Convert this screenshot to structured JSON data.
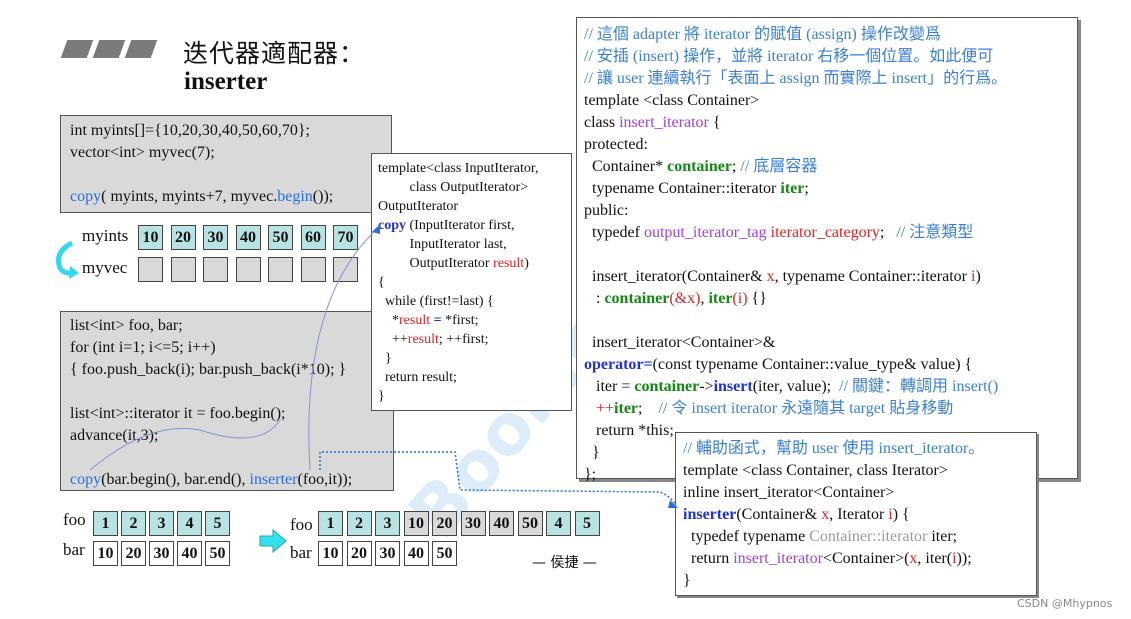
{
  "title": {
    "line1": "迭代器適配器：",
    "line2": "inserter"
  },
  "example1": [
    [
      [
        "int myints[]={10,20,30,40,50,60,70};",
        ""
      ]
    ],
    [
      [
        "vector<int> myvec(7);",
        ""
      ]
    ],
    [
      [
        "",
        ""
      ]
    ],
    [
      [
        "copy",
        "bl"
      ],
      [
        "( myints, myints+7, myvec.",
        ""
      ],
      [
        "begin",
        "bl"
      ],
      [
        "());",
        ""
      ]
    ]
  ],
  "arrays1": {
    "myints_label": "myints",
    "myvec_label": "myvec",
    "myints": [
      "10",
      "20",
      "30",
      "40",
      "50",
      "60",
      "70"
    ],
    "myvec": [
      "",
      "",
      "",
      "",
      "",
      "",
      ""
    ]
  },
  "example2": [
    [
      [
        "list<int> foo, bar;",
        ""
      ]
    ],
    [
      [
        "for (int i=1; i<=5; i++)",
        ""
      ]
    ],
    [
      [
        "{ foo.push_back(i); bar.push_back(i*10); }",
        ""
      ]
    ],
    [
      [
        "",
        ""
      ]
    ],
    [
      [
        "list<int>::iterator it = foo.begin();",
        ""
      ]
    ],
    [
      [
        "advance(it,3);",
        ""
      ]
    ],
    [
      [
        "",
        ""
      ]
    ],
    [
      [
        "copy",
        "bl"
      ],
      [
        "(bar.begin(), bar.end(), ",
        ""
      ],
      [
        "inserter",
        "bl"
      ],
      [
        "(foo,it));",
        ""
      ]
    ]
  ],
  "copy_box": [
    [
      [
        "template<class InputIterator,",
        ""
      ]
    ],
    [
      [
        "         class OutputIterator>",
        ""
      ]
    ],
    [
      [
        "OutputIterator",
        ""
      ]
    ],
    [
      [
        "copy",
        "bb"
      ],
      [
        " (InputIterator first,",
        ""
      ]
    ],
    [
      [
        "         InputIterator last,",
        ""
      ]
    ],
    [
      [
        "         OutputIterator ",
        ""
      ],
      [
        "result",
        "r"
      ],
      [
        ")",
        ""
      ]
    ],
    [
      [
        "{",
        ""
      ]
    ],
    [
      [
        "  while (first!=last) {",
        ""
      ]
    ],
    [
      [
        "    *",
        ""
      ],
      [
        "result",
        "r"
      ],
      [
        " ",
        ""
      ],
      [
        "=",
        "bb"
      ],
      [
        " *first;",
        ""
      ]
    ],
    [
      [
        "    ++",
        ""
      ],
      [
        "result",
        "r"
      ],
      [
        "; ++first;",
        ""
      ]
    ],
    [
      [
        "  }",
        ""
      ]
    ],
    [
      [
        "  return result;",
        ""
      ]
    ],
    [
      [
        "}",
        ""
      ]
    ]
  ],
  "insert_iterator_box": [
    [
      [
        "// 這個 adapter 將 iterator 的賦值 (assign) 操作改變爲",
        "c"
      ]
    ],
    [
      [
        "// 安插 (insert) 操作，並將 iterator 右移一個位置。如此便可",
        "c"
      ]
    ],
    [
      [
        "// 讓 user 連續執行「表面上 assign 而實際上 insert」的行爲。",
        "c"
      ]
    ],
    [
      [
        "template <class Container>",
        ""
      ]
    ],
    [
      [
        "class ",
        ""
      ],
      [
        "insert_iterator",
        "k"
      ],
      [
        " {",
        ""
      ]
    ],
    [
      [
        "protected:",
        ""
      ]
    ],
    [
      [
        "  Container* ",
        ""
      ],
      [
        "container",
        "g"
      ],
      [
        "; ",
        ""
      ],
      [
        "// 底層容器",
        "c"
      ]
    ],
    [
      [
        "  typename Container::iterator ",
        ""
      ],
      [
        "iter",
        "g"
      ],
      [
        ";",
        ""
      ]
    ],
    [
      [
        "public:",
        ""
      ]
    ],
    [
      [
        "  typedef ",
        ""
      ],
      [
        "output_iterator_tag",
        "k"
      ],
      [
        " ",
        ""
      ],
      [
        "iterator_category",
        "r"
      ],
      [
        ";   ",
        ""
      ],
      [
        "// 注意類型",
        "c"
      ]
    ],
    [
      [
        "",
        ""
      ]
    ],
    [
      [
        "  insert_iterator(Container& ",
        ""
      ],
      [
        "x",
        "r"
      ],
      [
        ", typename Container::iterator ",
        ""
      ],
      [
        "i",
        "r"
      ],
      [
        ")",
        ""
      ]
    ],
    [
      [
        "   : ",
        ""
      ],
      [
        "container",
        "g"
      ],
      [
        "(&x)",
        "r"
      ],
      [
        ", ",
        ""
      ],
      [
        "iter",
        "g"
      ],
      [
        "(i)",
        "r"
      ],
      [
        " {}",
        ""
      ]
    ],
    [
      [
        "",
        ""
      ]
    ],
    [
      [
        "  insert_iterator<Container>&",
        ""
      ]
    ],
    [
      [
        "operator=",
        "bb"
      ],
      [
        "(const typename Container::value_type& value) {",
        ""
      ]
    ],
    [
      [
        "   iter = ",
        ""
      ],
      [
        "container",
        "g"
      ],
      [
        "->",
        ""
      ],
      [
        "insert",
        "bb"
      ],
      [
        "(iter, value);  ",
        ""
      ],
      [
        "// 關鍵：轉調用 insert()",
        "c"
      ]
    ],
    [
      [
        "   ++",
        "r"
      ],
      [
        "iter",
        "g"
      ],
      [
        ";    ",
        ""
      ],
      [
        "// 令 insert iterator 永遠隨其 target 貼身移動",
        "c"
      ]
    ],
    [
      [
        "   return *this;",
        ""
      ]
    ],
    [
      [
        "  }",
        ""
      ]
    ],
    [
      [
        "};",
        ""
      ]
    ]
  ],
  "inserter_box": [
    [
      [
        "// 輔助函式，幫助 user 使用 insert_iterator。",
        "c"
      ]
    ],
    [
      [
        "template <class Container, class Iterator>",
        ""
      ]
    ],
    [
      [
        "inline insert_iterator<Container>",
        ""
      ]
    ],
    [
      [
        "inserter",
        "bb"
      ],
      [
        "(Container& ",
        ""
      ],
      [
        "x",
        "r"
      ],
      [
        ", Iterator ",
        ""
      ],
      [
        "i",
        "r"
      ],
      [
        ") {",
        ""
      ]
    ],
    [
      [
        "  typedef typename ",
        ""
      ],
      [
        "Container::iterator",
        "gr"
      ],
      [
        " iter;",
        ""
      ]
    ],
    [
      [
        "  return ",
        ""
      ],
      [
        "insert_iterator",
        "k"
      ],
      [
        "<Container>(",
        ""
      ],
      [
        "x",
        "r"
      ],
      [
        ", iter(",
        ""
      ],
      [
        "i",
        "r"
      ],
      [
        "));",
        ""
      ]
    ],
    [
      [
        "}",
        ""
      ]
    ]
  ],
  "arrays2": {
    "foo_label": "foo",
    "bar_label": "bar",
    "foo_before": [
      "1",
      "2",
      "3",
      "4",
      "5"
    ],
    "bar_before": [
      "10",
      "20",
      "30",
      "40",
      "50"
    ],
    "foo_after": [
      "1",
      "2",
      "3",
      "10",
      "20",
      "30",
      "40",
      "50",
      "4",
      "5"
    ],
    "foo_after_inserted": [
      false,
      false,
      false,
      true,
      true,
      true,
      true,
      true,
      false,
      false
    ],
    "bar_after": [
      "10",
      "20",
      "30",
      "40",
      "50"
    ]
  },
  "author": "— 侯捷 —",
  "watermark": "Boolan 博览网",
  "credit": "CSDN @Mhypnos",
  "colors": {
    "teal_cell": "#b9e2e2",
    "gray_box": "#d9d9d9",
    "comment": "#3b7fd9",
    "keyword": "#a040e0",
    "member": "#108a10",
    "param": "#e52020",
    "arrow": "#33e0f0"
  }
}
